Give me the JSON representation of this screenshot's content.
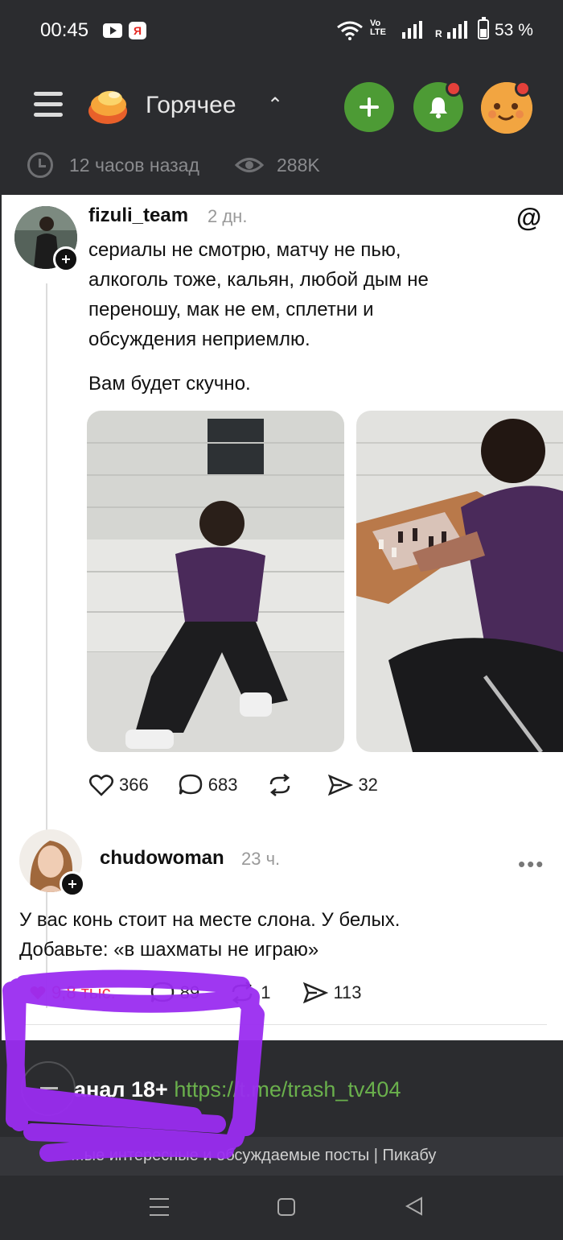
{
  "status_bar": {
    "time": "00:45",
    "youtube_icon": "youtube-icon",
    "yandex_icon": "yandex-browser-icon",
    "volte": "Vo LTE",
    "roaming": "R",
    "battery": "53 %"
  },
  "header": {
    "feed_title": "Горячее",
    "chevron": "^",
    "add_icon": "plus-icon",
    "bell_icon": "bell-icon",
    "colors": {
      "accent_green": "#4d9b35",
      "notify_red": "#e4403a",
      "bg": "#2b2c2f"
    }
  },
  "post_meta": {
    "time_ago": "12 часов назад",
    "views": "288K"
  },
  "threads_post": {
    "author": "fizuli_team",
    "ago": "2 дн.",
    "text_lines": [
      "сериалы не смотрю, матчу не пью,",
      "алкоголь тоже, кальян, любой дым не",
      "переношу, мак не ем, сплетни и",
      "обсуждения неприемлю."
    ],
    "text_2": "Вам будет скучно.",
    "likes": "366",
    "comments": "683",
    "shares": "32"
  },
  "reply": {
    "author": "chudowoman",
    "ago": "23 ч.",
    "text_lines": [
      "У вас конь стоит на месте слона. У белых.",
      "Добавьте: «в шахматы не играю»"
    ],
    "likes": "9,8 тыс.",
    "comments": "89",
    "reposts": "1",
    "shares": "113",
    "more": "•••"
  },
  "channel": {
    "label": "анал 18+",
    "link": "https://t.me/trash_tv404"
  },
  "footer": {
    "text": "...ые интересные и обсуждаемые посты | Пикабу"
  }
}
